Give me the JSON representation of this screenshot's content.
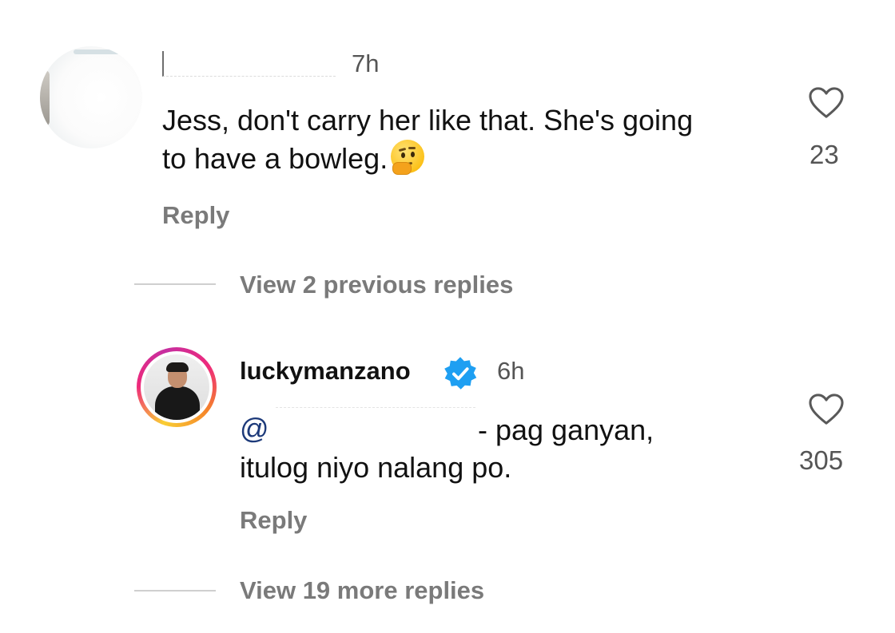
{
  "comments": [
    {
      "username": "",
      "time": "7h",
      "text": "Jess, don't carry her like that. She's going to have a bowleg.",
      "emoji": "thinking-face-icon",
      "reply_label": "Reply",
      "like_count": "23"
    },
    {
      "username": "luckymanzano",
      "verified": true,
      "time": "6h",
      "mention_prefix": "@",
      "text_line1": "- pag ganyan,",
      "text_line2": "itulog niyo nalang po.",
      "reply_label": "Reply",
      "like_count": "305"
    }
  ],
  "threads": {
    "previous_label": "View 2 previous replies",
    "more_label": "View 19 more replies"
  },
  "colors": {
    "text_primary": "#111111",
    "text_secondary": "#7a7a7a",
    "verified_blue": "#1e9ff2",
    "story_ring": [
      "#f9ce34",
      "#ee2a7b",
      "#c62ea0"
    ]
  }
}
